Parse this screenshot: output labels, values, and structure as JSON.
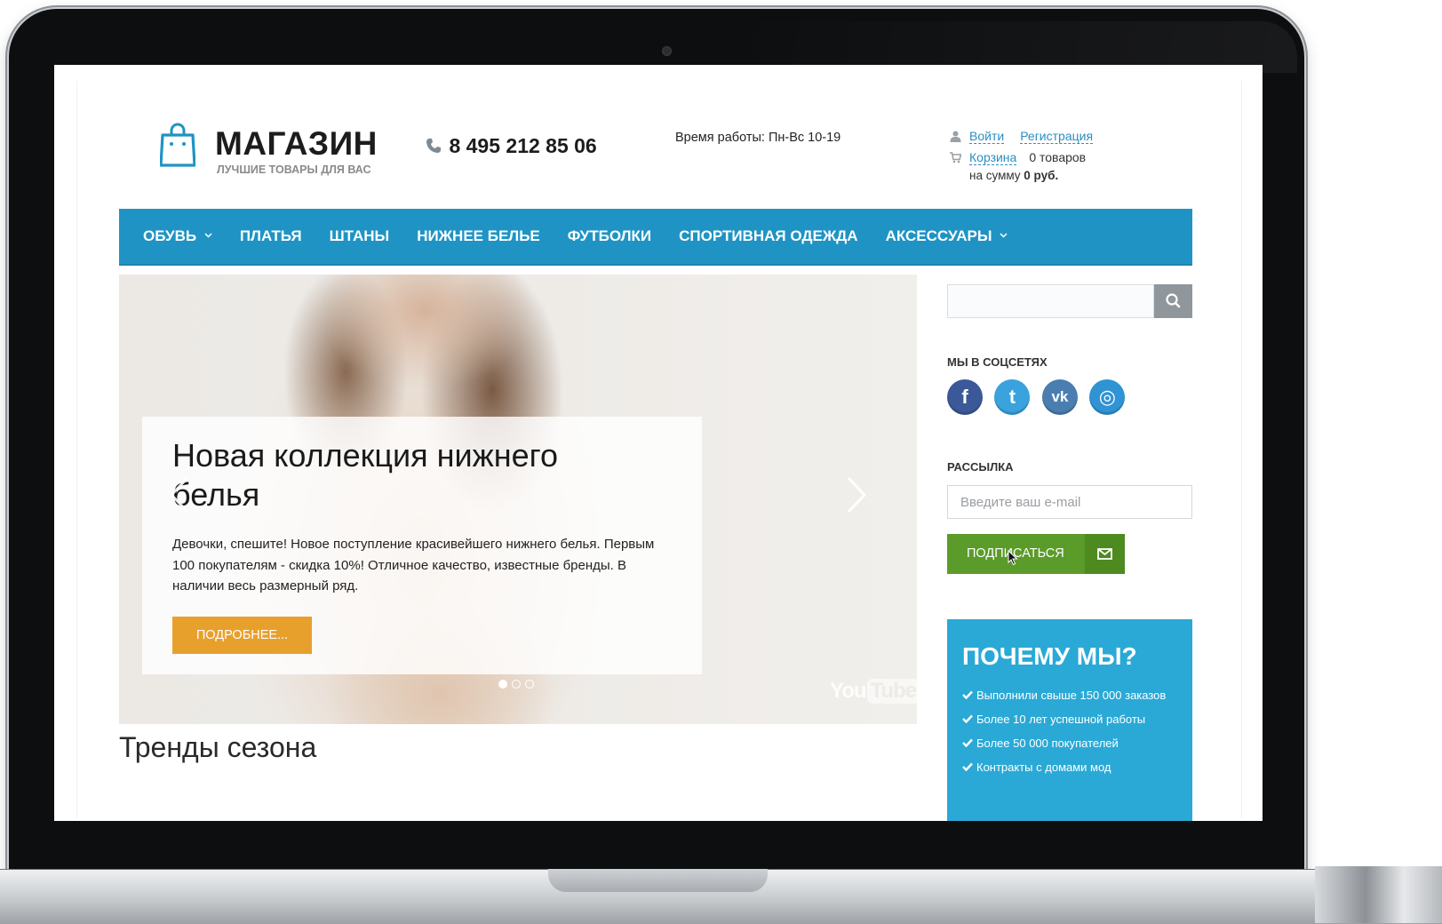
{
  "header": {
    "logo_title": "МАГАЗИН",
    "logo_subtitle": "ЛУЧШИЕ ТОВАРЫ ДЛЯ ВАС",
    "phone": "8 495 212 85 06",
    "hours": "Время работы: Пн-Вс 10-19"
  },
  "account": {
    "login": "Войти",
    "register": "Регистрация",
    "cart": "Корзина",
    "cart_count": "0 товаров",
    "sum_label": "на сумму",
    "sum_value": "0 руб."
  },
  "nav": {
    "items": [
      {
        "label": "ОБУВЬ",
        "dropdown": true
      },
      {
        "label": "ПЛАТЬЯ",
        "dropdown": false
      },
      {
        "label": "ШТАНЫ",
        "dropdown": false
      },
      {
        "label": "НИЖНЕЕ БЕЛЬЕ",
        "dropdown": false
      },
      {
        "label": "ФУТБОЛКИ",
        "dropdown": false
      },
      {
        "label": "СПОРТИВНАЯ ОДЕЖДА",
        "dropdown": false
      },
      {
        "label": "АКСЕССУАРЫ",
        "dropdown": true
      }
    ],
    "color": "#1f94c4"
  },
  "hero": {
    "title": "Новая коллекция нижнего белья",
    "text": "Девочки, спешите! Новое поступление красивейшего нижнего белья. Первым 100 покупателям - скидка 10%! Отличное качество, известные бренды. В наличии весь размерный ряд.",
    "button": "ПОДРОБНЕЕ...",
    "slides": 3,
    "active_slide": 1,
    "watermark_you": "You",
    "watermark_tube": "Tube"
  },
  "sections": {
    "trends_title": "Тренды сезона"
  },
  "sidebar": {
    "search": {
      "placeholder": "",
      "value": ""
    },
    "social_title": "МЫ В СОЦСЕТЯХ",
    "socials": [
      {
        "icon": "facebook-icon",
        "glyph": "f",
        "color": "#3b5998"
      },
      {
        "icon": "twitter-icon",
        "glyph": "t",
        "color": "#3aa2dc"
      },
      {
        "icon": "vk-icon",
        "glyph": "vk",
        "color": "#4a7eb0"
      },
      {
        "icon": "instagram-icon",
        "glyph": "◎",
        "color": "#2f93d4"
      }
    ],
    "newsletter_title": "РАССЫЛКА",
    "email_placeholder": "Введите ваш e-mail",
    "subscribe_label": "ПОДПИСАТЬСЯ",
    "why_title": "ПОЧЕМУ МЫ?",
    "why_items": [
      "Выполнили свыше 150 000 заказов",
      "Более 10 лет успешной работы",
      "Более 50 000 покупателей",
      "Контракты с домами мод"
    ]
  },
  "colors": {
    "accent": "#1f94c4",
    "cta_orange": "#e8a02d",
    "subscribe_green": "#5b9b2a",
    "why_blue": "#2aa9d6"
  }
}
